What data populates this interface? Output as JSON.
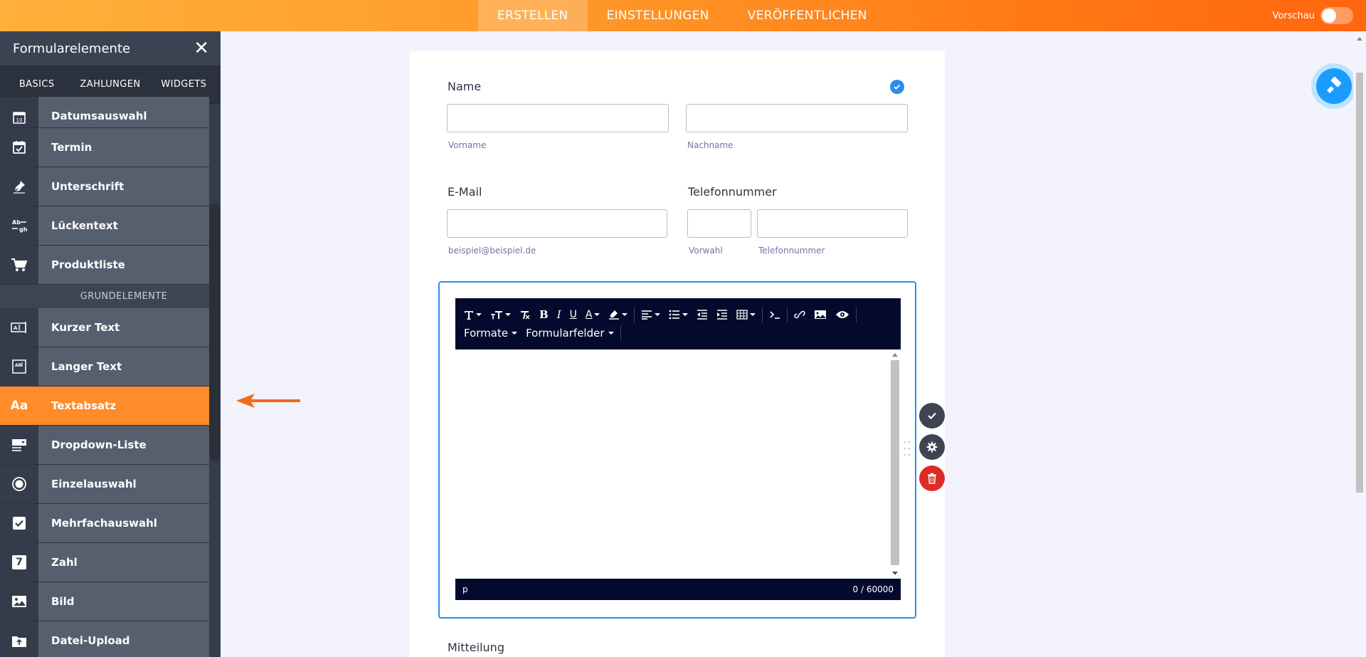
{
  "topbar": {
    "tabs": [
      {
        "label": "ERSTELLEN",
        "active": true
      },
      {
        "label": "EINSTELLUNGEN",
        "active": false
      },
      {
        "label": "VERÖFFENTLICHEN",
        "active": false
      }
    ],
    "preview_label": "Vorschau",
    "preview_on": false
  },
  "sidebar": {
    "title": "Formularelemente",
    "tabs": [
      "BASICS",
      "ZAHLUNGEN",
      "WIDGETS"
    ],
    "items_top": [
      {
        "label": "Datumsauswahl",
        "icon": "calendar-10-icon"
      },
      {
        "label": "Termin",
        "icon": "calendar-check-icon"
      },
      {
        "label": "Unterschrift",
        "icon": "pen-nib-icon"
      },
      {
        "label": "Lückentext",
        "icon": "fill-in-blank-icon"
      },
      {
        "label": "Produktliste",
        "icon": "cart-icon"
      }
    ],
    "section_label": "GRUNDELEMENTE",
    "items_bottom": [
      {
        "label": "Kurzer Text",
        "icon": "short-text-icon"
      },
      {
        "label": "Langer Text",
        "icon": "long-text-icon"
      },
      {
        "label": "Textabsatz",
        "icon": "text-paragraph-icon",
        "icon_text": "Aa",
        "active": true
      },
      {
        "label": "Dropdown-Liste",
        "icon": "dropdown-icon"
      },
      {
        "label": "Einzelauswahl",
        "icon": "radio-icon"
      },
      {
        "label": "Mehrfachauswahl",
        "icon": "checkbox-icon"
      },
      {
        "label": "Zahl",
        "icon": "number-icon",
        "icon_text": "7"
      },
      {
        "label": "Bild",
        "icon": "image-icon"
      },
      {
        "label": "Datei-Upload",
        "icon": "file-upload-icon"
      }
    ]
  },
  "form": {
    "name": {
      "label": "Name",
      "first_sublabel": "Vorname",
      "last_sublabel": "Nachname"
    },
    "email": {
      "label": "E-Mail",
      "sublabel": "beispiel@beispiel.de"
    },
    "phone": {
      "label": "Telefonnummer",
      "area_sublabel": "Vorwahl",
      "number_sublabel": "Telefonnummer"
    },
    "editor": {
      "dropdown_formats": "Formate",
      "dropdown_fields": "Formularfelder",
      "status_path": "p",
      "char_count": "0 / 60000"
    },
    "next_label": "Mitteilung"
  },
  "colors": {
    "accent_orange": "#ff8b2b",
    "selection_blue": "#2e8bf0",
    "editor_dark": "#040a2d",
    "delete_red": "#dd2c26"
  }
}
